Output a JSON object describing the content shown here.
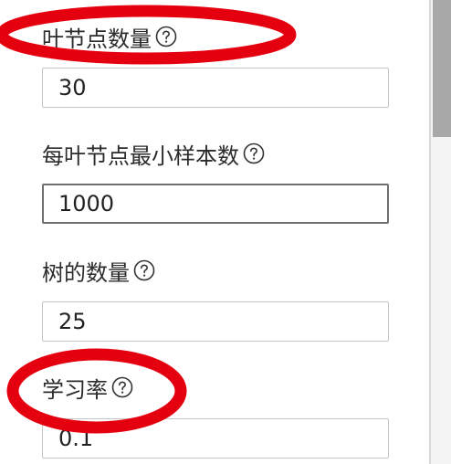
{
  "params": [
    {
      "label": "叶节点数量",
      "value": "30",
      "icon": "question-circle-icon"
    },
    {
      "label": "每叶节点最小样本数",
      "value": "1000",
      "icon": "question-circle-icon"
    },
    {
      "label": "树的数量",
      "value": "25",
      "icon": "question-circle-icon"
    },
    {
      "label": "学习率",
      "value": "0.1",
      "icon": "question-circle-icon"
    }
  ],
  "annotation": {
    "color": "#e4000f",
    "highlighted": [
      "叶节点数量",
      "学习率"
    ]
  }
}
